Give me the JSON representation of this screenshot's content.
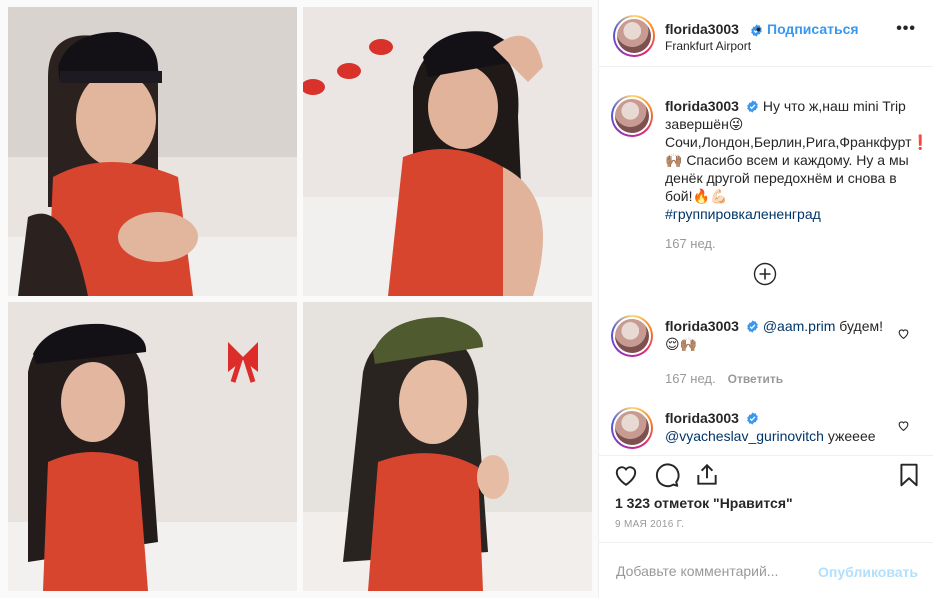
{
  "post": {
    "username": "florida3003",
    "follow_label": "Подписаться",
    "separator": "•",
    "location": "Frankfurt Airport",
    "more": "•••"
  },
  "caption": {
    "username": "florida3003",
    "text": "Ну что ж,наш mini Trip завершён😜 Сочи,Лондон,Берлин,Рига,Франкфурт❗🙌🏽 Спасибо всем и каждому. Ну а мы денёк другой передохнём и снова в бой!🔥💪🏻",
    "hashtag": "#группировкалененград",
    "time": "167 нед."
  },
  "comments": [
    {
      "username": "florida3003",
      "mention": "@aam.prim",
      "text": " будем! 😌🙌🏽",
      "time": "167 нед.",
      "reply_label": "Ответить"
    },
    {
      "username": "florida3003",
      "mention": "@vyacheslav_gurinovitch",
      "text": " ужееее"
    }
  ],
  "likes_text": "1 323 отметок \"Нравится\"",
  "date_text": "9 МАЯ 2016 Г.",
  "add_comment": {
    "placeholder": "Добавьте комментарий...",
    "publish_label": "Опубликовать"
  },
  "colors": {
    "link": "#3897f0",
    "mention": "#003569",
    "meta": "#999999",
    "publish_disabled": "#b2dffc",
    "swimsuit_red": "#d8452f"
  }
}
